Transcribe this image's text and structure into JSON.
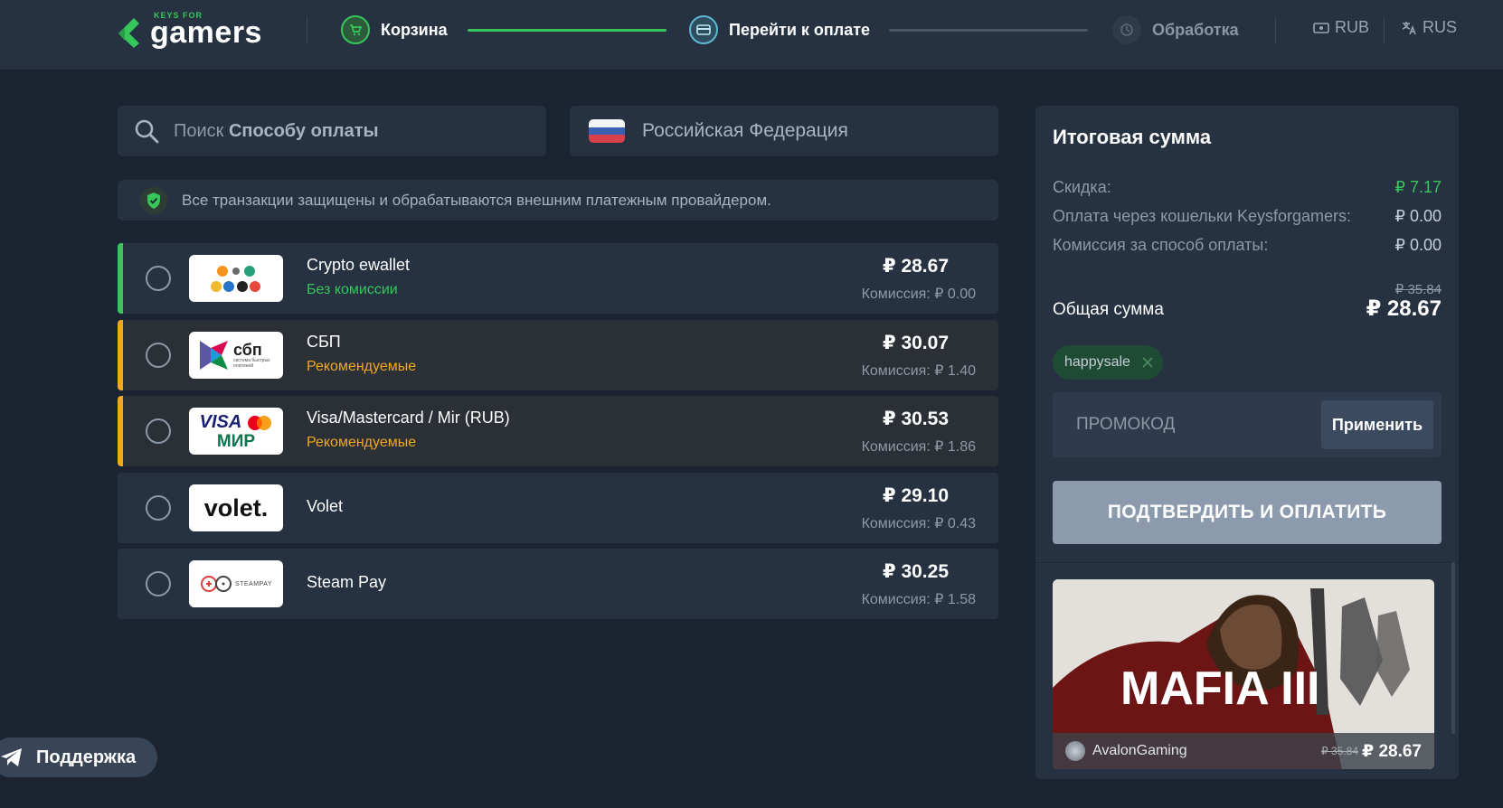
{
  "header": {
    "logo_small": "KEYS FOR",
    "logo_big": "gamers",
    "steps": [
      {
        "label": "Корзина",
        "state": "done"
      },
      {
        "label": "Перейти к оплате",
        "state": "active"
      },
      {
        "label": "Обработка",
        "state": "pending"
      }
    ],
    "currency": "RUB",
    "language": "RUS"
  },
  "search": {
    "placeholder_prefix": "Поиск",
    "placeholder_bold": "Способу оплаты"
  },
  "country": {
    "label": "Российская Федерация"
  },
  "notice": {
    "text": "Все транзакции защищены и обрабатываются внешним платежным провайдером."
  },
  "payment_methods": [
    {
      "name": "Crypto ewallet",
      "tag": "Без комиссии",
      "price": "₽ 28.67",
      "fee": "Комиссия: ₽ 0.00"
    },
    {
      "name": "СБП",
      "tag": "Рекомендуемые",
      "price": "₽ 30.07",
      "fee": "Комиссия: ₽ 1.40",
      "logo_text": "сбп",
      "logo_sub": "система быстрых платежей"
    },
    {
      "name": "Visa/Mastercard / Mir (RUB)",
      "tag": "Рекомендуемые",
      "price": "₽ 30.53",
      "fee": "Комиссия: ₽ 1.86",
      "logo_text": "VISA",
      "logo_sub": "МИР"
    },
    {
      "name": "Volet",
      "tag": "",
      "price": "₽ 29.10",
      "fee": "Комиссия: ₽ 0.43",
      "logo_text": "volet."
    },
    {
      "name": "Steam Pay",
      "tag": "",
      "price": "₽ 30.25",
      "fee": "Комиссия: ₽ 1.58",
      "logo_text": "STEAMPAY"
    }
  ],
  "summary": {
    "title": "Итоговая сумма",
    "rows": [
      {
        "label": "Скидка:",
        "value": "₽ 7.17"
      },
      {
        "label": "Оплата через кошельки Keysforgamers:",
        "value": "₽ 0.00"
      },
      {
        "label": "Комиссия за способ оплаты:",
        "value": "₽ 0.00"
      }
    ],
    "total_old": "₽ 35.84",
    "total_label": "Общая сумма",
    "total_value": "₽ 28.67",
    "coupon": "happysale",
    "promo_placeholder": "ПРОМОКОД",
    "apply_label": "Применить",
    "pay_label": "ПОДТВЕРДИТЬ И ОПЛАТИТЬ"
  },
  "product": {
    "title_art": "MAFIA III",
    "seller": "AvalonGaming",
    "old_price": "₽ 35.84",
    "price": "₽ 28.67"
  },
  "support": {
    "label": "Поддержка"
  },
  "colors": {
    "accent_green": "#35c75a",
    "accent_orange": "#f0a81d",
    "background": "#1b2430",
    "panel": "#263241"
  }
}
